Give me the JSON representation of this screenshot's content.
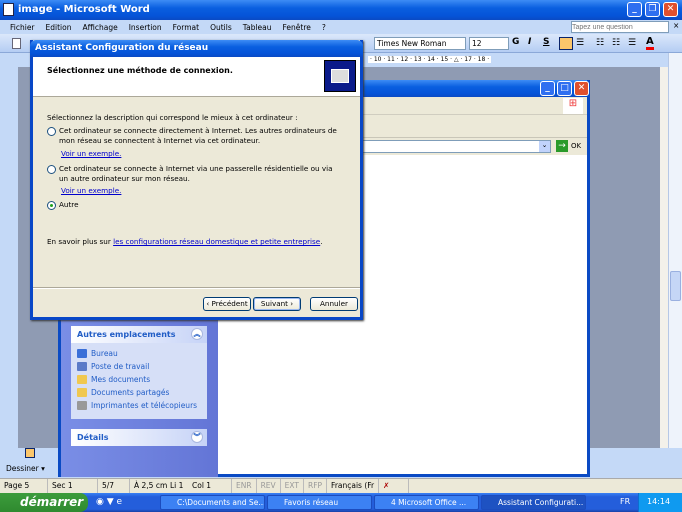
{
  "word": {
    "title": "image - Microsoft Word",
    "menu": [
      "Fichier",
      "Edition",
      "Affichage",
      "Insertion",
      "Format",
      "Outils",
      "Tableau",
      "Fenêtre",
      "?"
    ],
    "help_placeholder": "Tapez une question",
    "font": "Times New Roman",
    "size": "12",
    "bold": "G",
    "italic": "I",
    "underline": "S",
    "ruler_ticks": "· 10 · 11 · 12 · 13 · 14 · 15 · △ · 17 · 18 ·",
    "drawing": "Dessiner ▾"
  },
  "status": {
    "page": "Page 5",
    "section": "Sec 1",
    "pages": "5/7",
    "at": "À 2,5 cm",
    "line": "Li 1",
    "col": "Col 1",
    "enr": "ENR",
    "rev": "REV",
    "ext": "EXT",
    "rfp": "RFP",
    "lang": "Français (Fr"
  },
  "taskbar": {
    "start": "démarrer",
    "tasks": [
      "C:\\Documents and Se...",
      "Favoris réseau",
      "4 Microsoft Office ...",
      "Assistant Configurati..."
    ],
    "lang": "FR",
    "time": "14:14"
  },
  "explorer": {
    "go": "OK",
    "places_title": "Autres emplacements",
    "places": [
      "Bureau",
      "Poste de travail",
      "Mes documents",
      "Documents partagés",
      "Imprimantes et télécopieurs"
    ],
    "details_title": "Détails"
  },
  "dialog": {
    "title": "Assistant Configuration du réseau",
    "heading": "Sélectionnez une méthode de connexion.",
    "prompt": "Sélectionnez la description qui correspond le mieux à cet ordinateur :",
    "option1": "Cet ordinateur se connecte directement à Internet. Les autres ordinateurs de mon réseau se connectent à Internet via cet ordinateur.",
    "option2": "Cet ordinateur se connecte à Internet via une passerelle résidentielle ou via un autre ordinateur sur mon réseau.",
    "option3": "Autre",
    "example1": "Voir un exemple.",
    "example2": "Voir un exemple.",
    "learn_prefix": "En savoir plus sur ",
    "learn_link": "les configurations réseau domestique et petite entreprise",
    "learn_suffix": ".",
    "back": "‹ Précédent",
    "next": "Suivant ›",
    "cancel": "Annuler",
    "selected_option": 3
  }
}
